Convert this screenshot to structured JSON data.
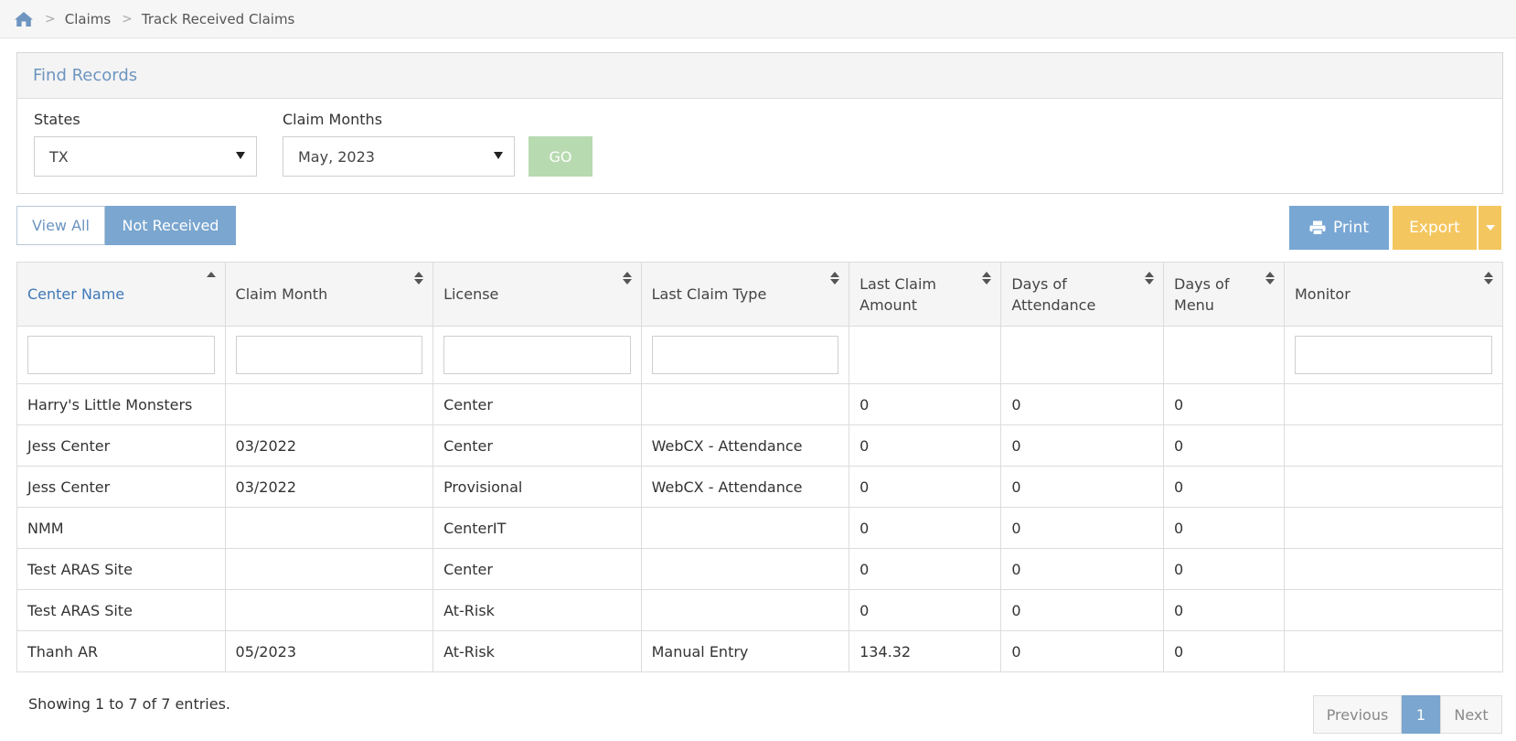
{
  "breadcrumb": {
    "items": [
      "Claims",
      "Track Received Claims"
    ]
  },
  "panel": {
    "title": "Find Records",
    "states_label": "States",
    "states_value": "TX",
    "claim_months_label": "Claim Months",
    "claim_months_value": "May, 2023",
    "go_label": "GO"
  },
  "filters": {
    "view_all": "View All",
    "not_received": "Not Received"
  },
  "toolbar": {
    "print_label": "Print",
    "export_label": "Export"
  },
  "table": {
    "columns": [
      "Center Name",
      "Claim Month",
      "License",
      "Last Claim Type",
      "Last Claim Amount",
      "Days of Attendance",
      "Days of Menu",
      "Monitor"
    ],
    "rows": [
      [
        "Harry's Little Monsters",
        "",
        "Center",
        "",
        "0",
        "0",
        "0",
        ""
      ],
      [
        "Jess Center",
        "03/2022",
        "Center",
        "WebCX - Attendance",
        "0",
        "0",
        "0",
        ""
      ],
      [
        "Jess Center",
        "03/2022",
        "Provisional",
        "WebCX - Attendance",
        "0",
        "0",
        "0",
        ""
      ],
      [
        "NMM",
        "",
        "CenterIT",
        "",
        "0",
        "0",
        "0",
        ""
      ],
      [
        "Test ARAS Site",
        "",
        "Center",
        "",
        "0",
        "0",
        "0",
        ""
      ],
      [
        "Test ARAS Site",
        "",
        "At-Risk",
        "",
        "0",
        "0",
        "0",
        ""
      ],
      [
        "Thanh AR",
        "05/2023",
        "At-Risk",
        "Manual Entry",
        "134.32",
        "0",
        "0",
        ""
      ]
    ]
  },
  "footer": {
    "showing": "Showing 1 to 7 of 7 entries.",
    "previous": "Previous",
    "page": "1",
    "next": "Next"
  },
  "colors": {
    "accent": "#7aa6cf",
    "export": "#f4c65f",
    "go": "#b8dab1",
    "link": "#3f78b8"
  }
}
